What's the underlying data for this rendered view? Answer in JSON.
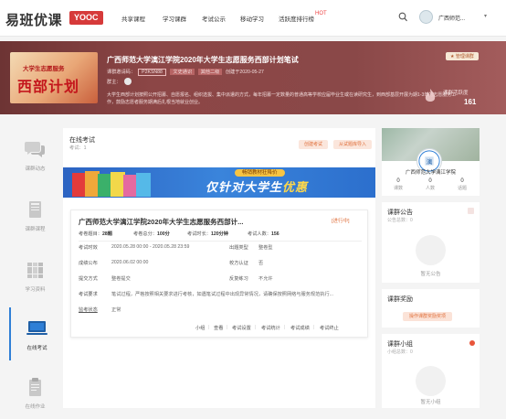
{
  "header": {
    "logo_text": "易班优课",
    "logo_badge": "YOOC",
    "nav": [
      "共享课程",
      "学习课群",
      "考试公示",
      "移动学习",
      "活跃度排行榜"
    ],
    "hot_tag": "HOT",
    "user": "广西师范..."
  },
  "banner": {
    "cover_line1": "大学生志愿服务",
    "cover_line2": "西部计划",
    "title": "广西师范大学漓江学院2020年大学生志愿服务西部计划笔试",
    "meta_label": "课群邀请码：",
    "code": "P2KSN88",
    "tag1": "文史通识",
    "tag2": "其他二级",
    "created": "创建于2020-05-27",
    "owner_label": "群主：",
    "description": "大学生西部计划按照公开招募、自愿报名、组织选拔、集中派遣的方式，每年招募一定数量的普通高等学校应届毕业生或在读研究生，到西部基层开展为期1-3年的志愿服务工作，鼓励志愿者服务期满后扎根当地就业创业。",
    "fav_button": "★ 管理课群",
    "stat_label": "课群活跃度",
    "stat_value": "161"
  },
  "left_nav": [
    {
      "label": "课群动态",
      "icon": "chat-bubbles-icon"
    },
    {
      "label": "课群课程",
      "icon": "book-icon"
    },
    {
      "label": "学习资料",
      "icon": "books-stack-icon"
    },
    {
      "label": "在线考试",
      "icon": "monitor-icon"
    },
    {
      "label": "在线作业",
      "icon": "clipboard-icon"
    }
  ],
  "exam_section": {
    "title": "在线考试",
    "count": "考试：1",
    "btn_create": "创建考试",
    "btn_import": "从试题库导入"
  },
  "ad": {
    "top_text": "畅销教材狂降价",
    "main_text_a": "仅针对大学生",
    "main_text_b": "优惠"
  },
  "exam_card": {
    "title": "广西师范大学漓江学院2020年大学生志愿服务西部计...",
    "status": "[进行中]",
    "info": [
      {
        "k": "考卷题目：",
        "v": "28题"
      },
      {
        "k": "考卷总分：",
        "v": "100分"
      },
      {
        "k": "考试时长：",
        "v": "120分钟"
      },
      {
        "k": "考试人数：",
        "v": "156"
      }
    ],
    "rows": [
      {
        "k1": "考试时效",
        "v1": "2020.05.28 00:00 - 2020.05.28 23:59",
        "k2": "出题类型",
        "v2": "整卷型"
      },
      {
        "k1": "成绩公布",
        "v1": "2020.06.02 00:00",
        "k2": "校方认证",
        "v2": "否"
      },
      {
        "k1": "提交方式",
        "v1": "整卷提交",
        "k2": "反复练习",
        "v2": "不允许"
      },
      {
        "k1": "考试要求",
        "v1": "笔试过程，严格按照相关要求进行考核，如遇笔试过程中出现异常情况，请确保按照网络与服务规范执行...",
        "k2": "",
        "v2": ""
      }
    ],
    "monitor_label": "监考状态",
    "monitor_value": "正常",
    "links": [
      "小组",
      "查看",
      "考试设置",
      "考试统计",
      "考试成绩",
      "考试终止"
    ]
  },
  "profile": {
    "name": "广西师范大学漓江学院",
    "stats": [
      {
        "n": "0",
        "t": "课数"
      },
      {
        "n": "0",
        "t": "人数"
      },
      {
        "n": "0",
        "t": "话题"
      }
    ]
  },
  "announcements": {
    "title": "课群公告",
    "sub": "公告总数：0",
    "empty": "暂无公告"
  },
  "awards": {
    "title": "课群奖励",
    "btn": "操作课群奖励奖项"
  },
  "groups": {
    "title": "课群小组",
    "sub": "小组总数：0",
    "empty": "暂无小组"
  },
  "colors": {
    "brand": "#d63a3a",
    "banner": "#8c4646",
    "accent_orange": "#e0703c",
    "link_blue": "#2f7fd6"
  }
}
